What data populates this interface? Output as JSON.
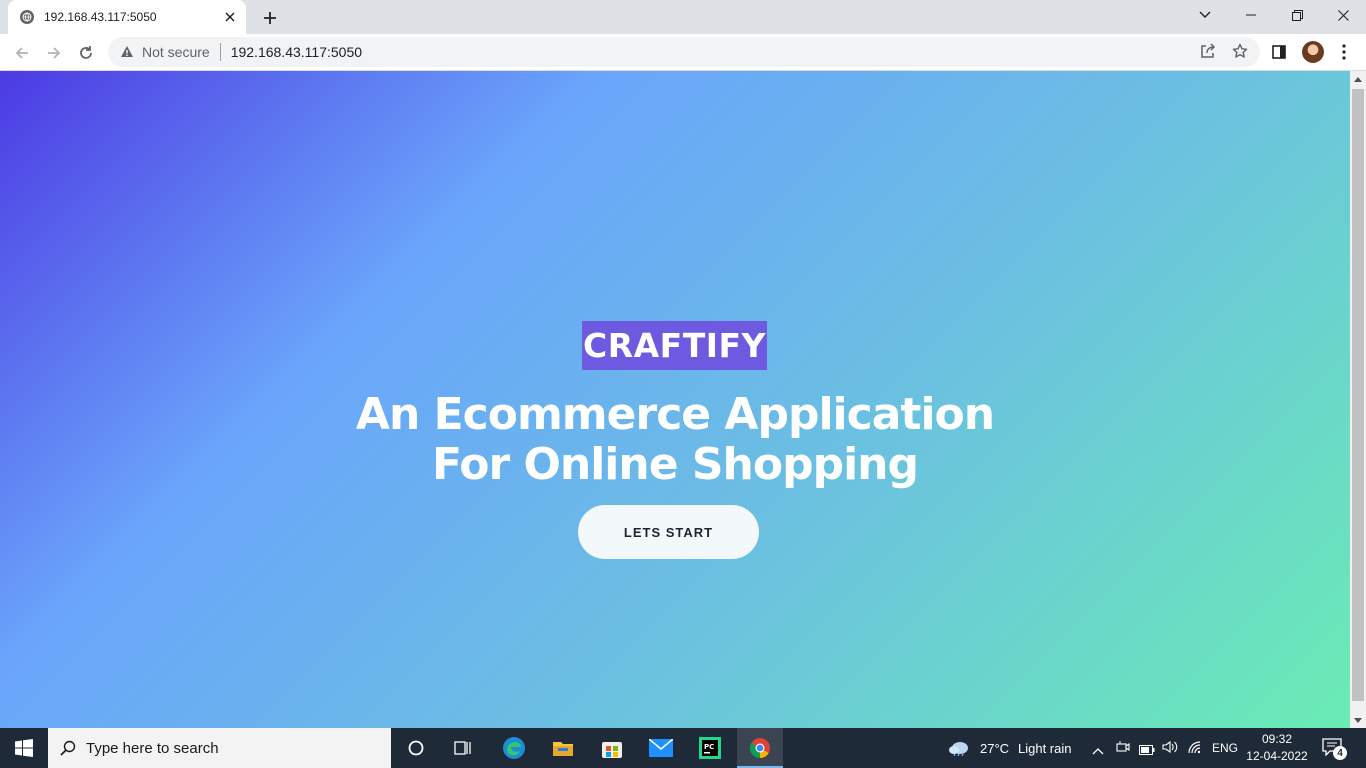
{
  "browser": {
    "tab_title": "192.168.43.117:5050",
    "security_label": "Not secure",
    "url": "192.168.43.117:5050"
  },
  "page": {
    "brand": "CRAFTIFY",
    "headline_line1": "An Ecommerce Application",
    "headline_line2": "For Online Shopping",
    "cta_label": "LETS START",
    "colors": {
      "gradient_start": "#4c3ae3",
      "gradient_mid": "#6aa5fb",
      "gradient_end": "#6aecb4",
      "brand_bg": "#6d5ae0",
      "cta_bg": "#f3f9fb"
    }
  },
  "taskbar": {
    "search_placeholder": "Type here to search",
    "weather_temp": "27°C",
    "weather_desc": "Light rain",
    "language": "ENG",
    "time": "09:32",
    "date": "12-04-2022",
    "notification_count": "4",
    "apps": [
      "cortana-icon",
      "task-view-icon",
      "edge-icon",
      "file-explorer-icon",
      "store-icon",
      "mail-icon",
      "pycharm-icon",
      "chrome-icon"
    ]
  }
}
